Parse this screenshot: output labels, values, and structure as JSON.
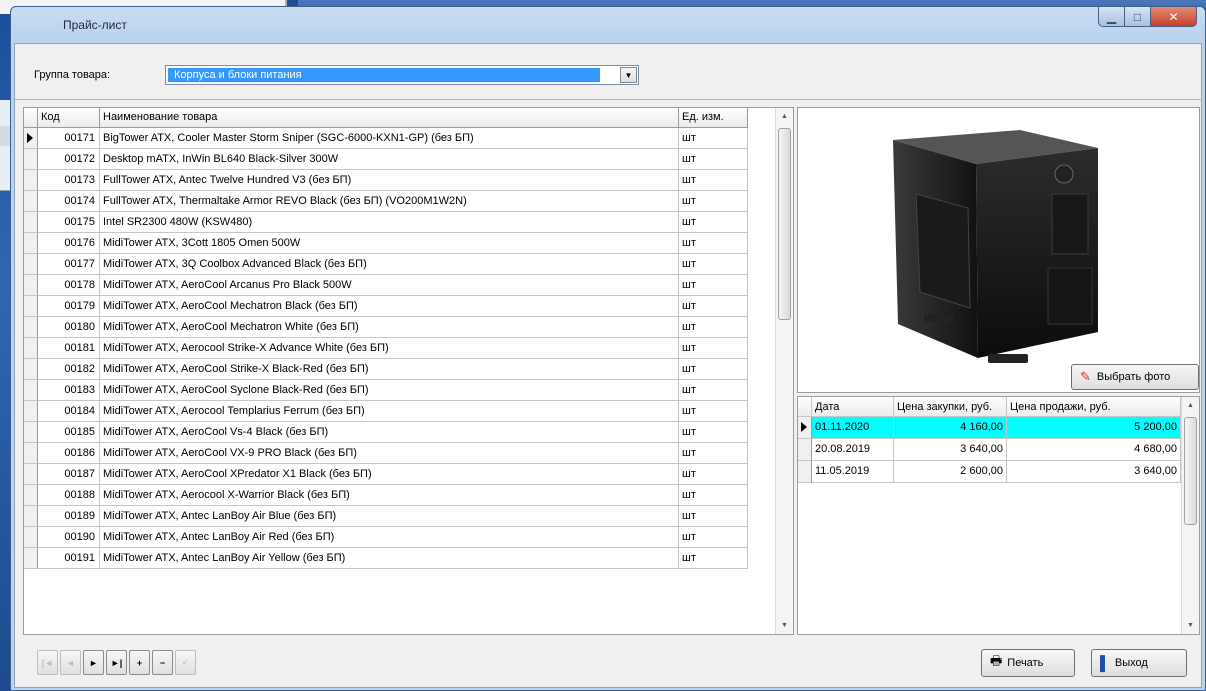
{
  "window": {
    "title": "Прайс-лист"
  },
  "filter": {
    "label": "Группа товара:",
    "selected": "Корпуса и блоки питания"
  },
  "products": {
    "columns": [
      "Код",
      "Наименование товара",
      "Ед. изм."
    ],
    "rows": [
      [
        "00171",
        "BigTower ATX, Cooler Master Storm Sniper (SGC-6000-KXN1-GP) (без БП)",
        "шт"
      ],
      [
        "00172",
        "Desktop mATX, InWin BL640 Black-Silver 300W",
        "шт"
      ],
      [
        "00173",
        "FullTower ATX, Antec Twelve Hundred V3 (без БП)",
        "шт"
      ],
      [
        "00174",
        "FullTower ATX, Thermaltake Armor REVO Black (без БП) (VO200M1W2N)",
        "шт"
      ],
      [
        "00175",
        "Intel SR2300 480W (KSW480)",
        "шт"
      ],
      [
        "00176",
        "MidiTower ATX, 3Cott 1805 Omen 500W",
        "шт"
      ],
      [
        "00177",
        "MidiTower ATX, 3Q Coolbox Advanced Black (без БП)",
        "шт"
      ],
      [
        "00178",
        "MidiTower ATX, AeroCool Arcanus Pro Black 500W",
        "шт"
      ],
      [
        "00179",
        "MidiTower ATX, AeroCool Mechatron Black (без БП)",
        "шт"
      ],
      [
        "00180",
        "MidiTower ATX, AeroCool Mechatron White (без БП)",
        "шт"
      ],
      [
        "00181",
        "MidiTower ATX, Aerocool Strike-X Advance White (без БП)",
        "шт"
      ],
      [
        "00182",
        "MidiTower ATX, AeroCool Strike-X Black-Red (без БП)",
        "шт"
      ],
      [
        "00183",
        "MidiTower ATX, AeroCool Syclone Black-Red (без БП)",
        "шт"
      ],
      [
        "00184",
        "MidiTower ATX, Aerocool Templarius Ferrum (без БП)",
        "шт"
      ],
      [
        "00185",
        "MidiTower ATX, AeroCool Vs-4 Black (без БП)",
        "шт"
      ],
      [
        "00186",
        "MidiTower ATX, AeroCool VX-9 PRO Black (без БП)",
        "шт"
      ],
      [
        "00187",
        "MidiTower ATX, AeroCool XPredator X1 Black (без БП)",
        "шт"
      ],
      [
        "00188",
        "MidiTower ATX, Aerocool X-Warrior Black (без БП)",
        "шт"
      ],
      [
        "00189",
        "MidiTower ATX, Antec LanBoy Air Blue (без БП)",
        "шт"
      ],
      [
        "00190",
        "MidiTower ATX, Antec LanBoy Air Red (без БП)",
        "шт"
      ],
      [
        "00191",
        "MidiTower ATX, Antec LanBoy Air Yellow (без БП)",
        "шт"
      ]
    ],
    "current_row": 0
  },
  "photo": {
    "button_label": "Выбрать фото",
    "icon": "pin-icon"
  },
  "prices": {
    "columns": [
      "Дата",
      "Цена закупки, руб.",
      "Цена продажи, руб."
    ],
    "rows": [
      [
        "01.11.2020",
        "4 160,00",
        "5 200,00"
      ],
      [
        "20.08.2019",
        "3 640,00",
        "4 680,00"
      ],
      [
        "11.05.2019",
        "2 600,00",
        "3 640,00"
      ]
    ],
    "current_row": 0,
    "highlight_color": "#00ffff"
  },
  "navigator": {
    "buttons": [
      {
        "name": "first-icon",
        "glyph": "|◄",
        "enabled": false
      },
      {
        "name": "prior-icon",
        "glyph": "◄",
        "enabled": false
      },
      {
        "name": "next-icon",
        "glyph": "►",
        "enabled": true
      },
      {
        "name": "last-icon",
        "glyph": "►|",
        "enabled": true
      },
      {
        "name": "insert-icon",
        "glyph": "+",
        "enabled": true
      },
      {
        "name": "delete-icon",
        "glyph": "−",
        "enabled": true
      },
      {
        "name": "post-icon",
        "glyph": "✓",
        "enabled": false
      }
    ]
  },
  "actions": {
    "print_label": "Печать",
    "exit_label": "Выход"
  }
}
